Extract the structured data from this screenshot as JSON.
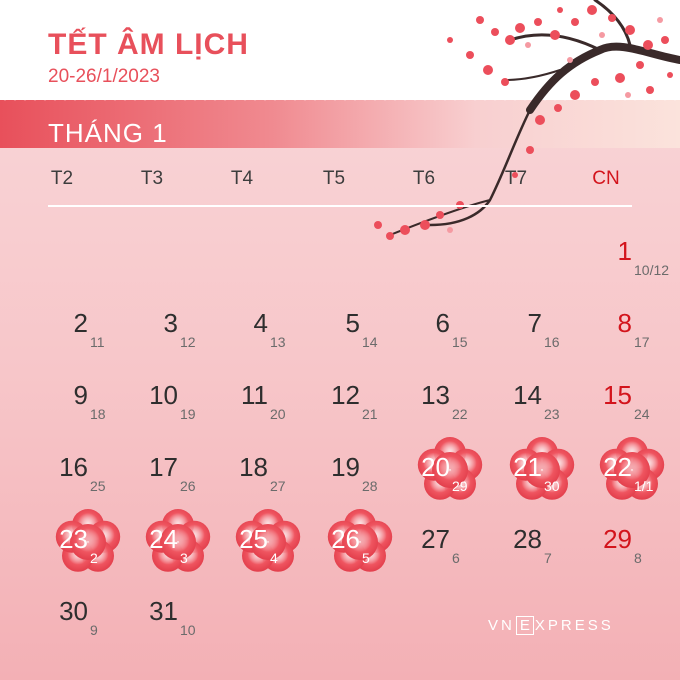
{
  "header": {
    "title": "TẾT ÂM LỊCH",
    "subtitle": "20-26/1/2023"
  },
  "calendar": {
    "month_label": "THÁNG 1",
    "weekdays": [
      "T2",
      "T3",
      "T4",
      "T5",
      "T6",
      "T7",
      "CN"
    ],
    "days": [
      {
        "day": "1",
        "lunar": "10/12",
        "col": 6,
        "row": 0,
        "tet": false
      },
      {
        "day": "2",
        "lunar": "11",
        "col": 0,
        "row": 1,
        "tet": false
      },
      {
        "day": "3",
        "lunar": "12",
        "col": 1,
        "row": 1,
        "tet": false
      },
      {
        "day": "4",
        "lunar": "13",
        "col": 2,
        "row": 1,
        "tet": false
      },
      {
        "day": "5",
        "lunar": "14",
        "col": 3,
        "row": 1,
        "tet": false
      },
      {
        "day": "6",
        "lunar": "15",
        "col": 4,
        "row": 1,
        "tet": false
      },
      {
        "day": "7",
        "lunar": "16",
        "col": 5,
        "row": 1,
        "tet": false
      },
      {
        "day": "8",
        "lunar": "17",
        "col": 6,
        "row": 1,
        "tet": false
      },
      {
        "day": "9",
        "lunar": "18",
        "col": 0,
        "row": 2,
        "tet": false
      },
      {
        "day": "10",
        "lunar": "19",
        "col": 1,
        "row": 2,
        "tet": false
      },
      {
        "day": "11",
        "lunar": "20",
        "col": 2,
        "row": 2,
        "tet": false
      },
      {
        "day": "12",
        "lunar": "21",
        "col": 3,
        "row": 2,
        "tet": false
      },
      {
        "day": "13",
        "lunar": "22",
        "col": 4,
        "row": 2,
        "tet": false
      },
      {
        "day": "14",
        "lunar": "23",
        "col": 5,
        "row": 2,
        "tet": false
      },
      {
        "day": "15",
        "lunar": "24",
        "col": 6,
        "row": 2,
        "tet": false
      },
      {
        "day": "16",
        "lunar": "25",
        "col": 0,
        "row": 3,
        "tet": false
      },
      {
        "day": "17",
        "lunar": "26",
        "col": 1,
        "row": 3,
        "tet": false
      },
      {
        "day": "18",
        "lunar": "27",
        "col": 2,
        "row": 3,
        "tet": false
      },
      {
        "day": "19",
        "lunar": "28",
        "col": 3,
        "row": 3,
        "tet": false
      },
      {
        "day": "20",
        "lunar": "29",
        "col": 4,
        "row": 3,
        "tet": true
      },
      {
        "day": "21",
        "lunar": "30",
        "col": 5,
        "row": 3,
        "tet": true
      },
      {
        "day": "22",
        "lunar": "1/1",
        "col": 6,
        "row": 3,
        "tet": true
      },
      {
        "day": "23",
        "lunar": "2",
        "col": 0,
        "row": 4,
        "tet": true
      },
      {
        "day": "24",
        "lunar": "3",
        "col": 1,
        "row": 4,
        "tet": true
      },
      {
        "day": "25",
        "lunar": "4",
        "col": 2,
        "row": 4,
        "tet": true
      },
      {
        "day": "26",
        "lunar": "5",
        "col": 3,
        "row": 4,
        "tet": true
      },
      {
        "day": "27",
        "lunar": "6",
        "col": 4,
        "row": 4,
        "tet": false
      },
      {
        "day": "28",
        "lunar": "7",
        "col": 5,
        "row": 4,
        "tet": false
      },
      {
        "day": "29",
        "lunar": "8",
        "col": 6,
        "row": 4,
        "tet": false
      },
      {
        "day": "30",
        "lunar": "9",
        "col": 0,
        "row": 5,
        "tet": false
      },
      {
        "day": "31",
        "lunar": "10",
        "col": 1,
        "row": 5,
        "tet": false
      }
    ]
  },
  "colors": {
    "accent": "#e8505b",
    "sunday": "#d3141c",
    "tet_flower": "#ef5560"
  },
  "logo": {
    "pre": "VN",
    "box": "E",
    "post": "XPRESS"
  },
  "decor": {
    "icon": "cherry-blossom-branch-icon"
  }
}
